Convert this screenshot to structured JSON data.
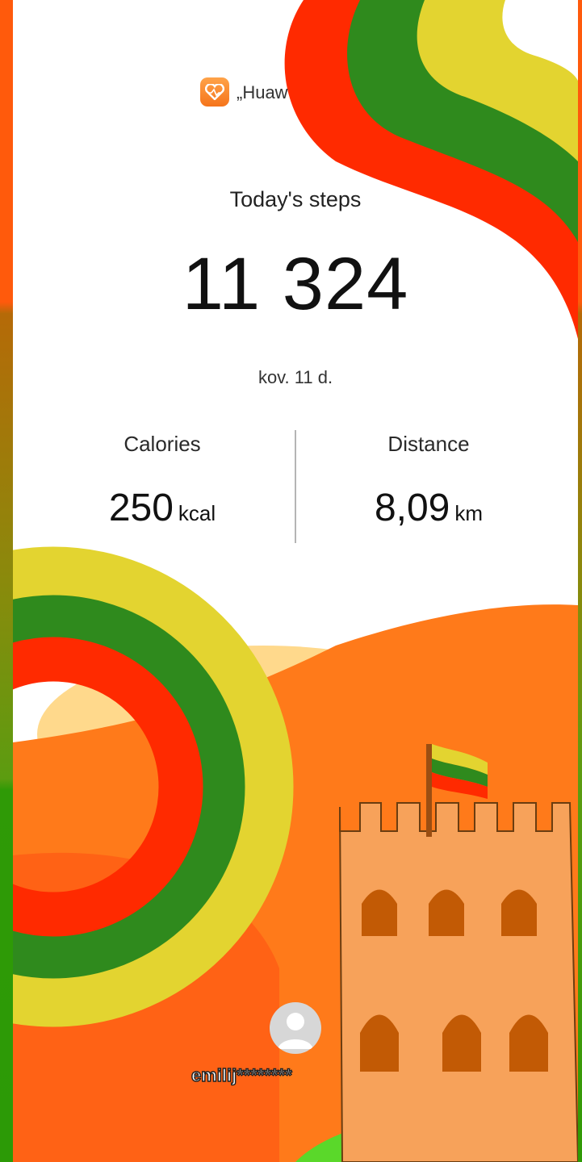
{
  "app": {
    "name": "„Huaw",
    "icon": "huawei-health-heart-icon"
  },
  "steps": {
    "title": "Today's steps",
    "value": "11 324",
    "date": "kov. 11 d."
  },
  "calories": {
    "label": "Calories",
    "value": "250",
    "unit": "kcal"
  },
  "distance": {
    "label": "Distance",
    "value": "8,09",
    "unit": "km"
  },
  "user": {
    "name": "emilij********",
    "avatar": "default-avatar-icon"
  },
  "colors": {
    "flag_yellow": "#e3d430",
    "flag_green": "#2f8a1d",
    "flag_red": "#ff2a00",
    "hill_orange": "#ff7a1a",
    "castle": "#f7a25a",
    "grass": "#5ad82a"
  }
}
